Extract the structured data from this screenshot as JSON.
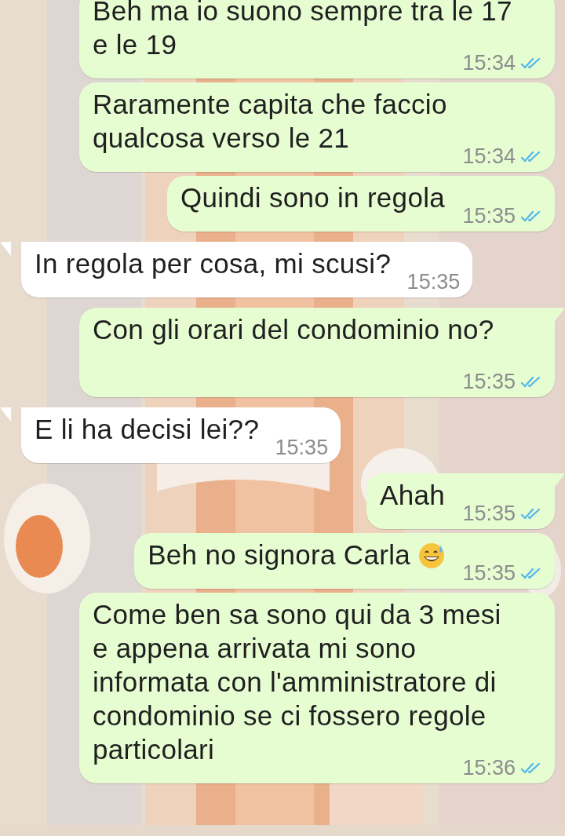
{
  "messages": [
    {
      "kind": "outgoing",
      "text": "Beh ma io suono sempre tra le 17 e le 19",
      "time": "15:34",
      "read": true,
      "tail": false
    },
    {
      "kind": "outgoing",
      "text": "Raramente capita che faccio qualcosa verso le 21",
      "time": "15:34",
      "read": true,
      "tail": false
    },
    {
      "kind": "outgoing",
      "text": "Quindi sono in regola",
      "time": "15:35",
      "read": true,
      "tail": false
    },
    {
      "kind": "incoming",
      "text": "In regola per cosa, mi scusi?",
      "time": "15:35",
      "tail": true
    },
    {
      "kind": "outgoing",
      "text": "Con gli orari del condominio no?",
      "time": "15:35",
      "read": true,
      "tail": true
    },
    {
      "kind": "incoming",
      "text": "E li ha decisi lei??",
      "time": "15:35",
      "tail": true
    },
    {
      "kind": "outgoing",
      "text": "Ahah",
      "time": "15:35",
      "read": true,
      "tail": true
    },
    {
      "kind": "outgoing",
      "text": "Beh no signora Carla",
      "emoji": true,
      "time": "15:35",
      "read": true,
      "tail": false
    },
    {
      "kind": "outgoing",
      "text": "Come ben sa sono qui da 3 mesi e appena arrivata mi sono informata con l'amministratore di condominio se ci fossero regole particolari",
      "time": "15:36",
      "read": true,
      "tail": false
    }
  ]
}
